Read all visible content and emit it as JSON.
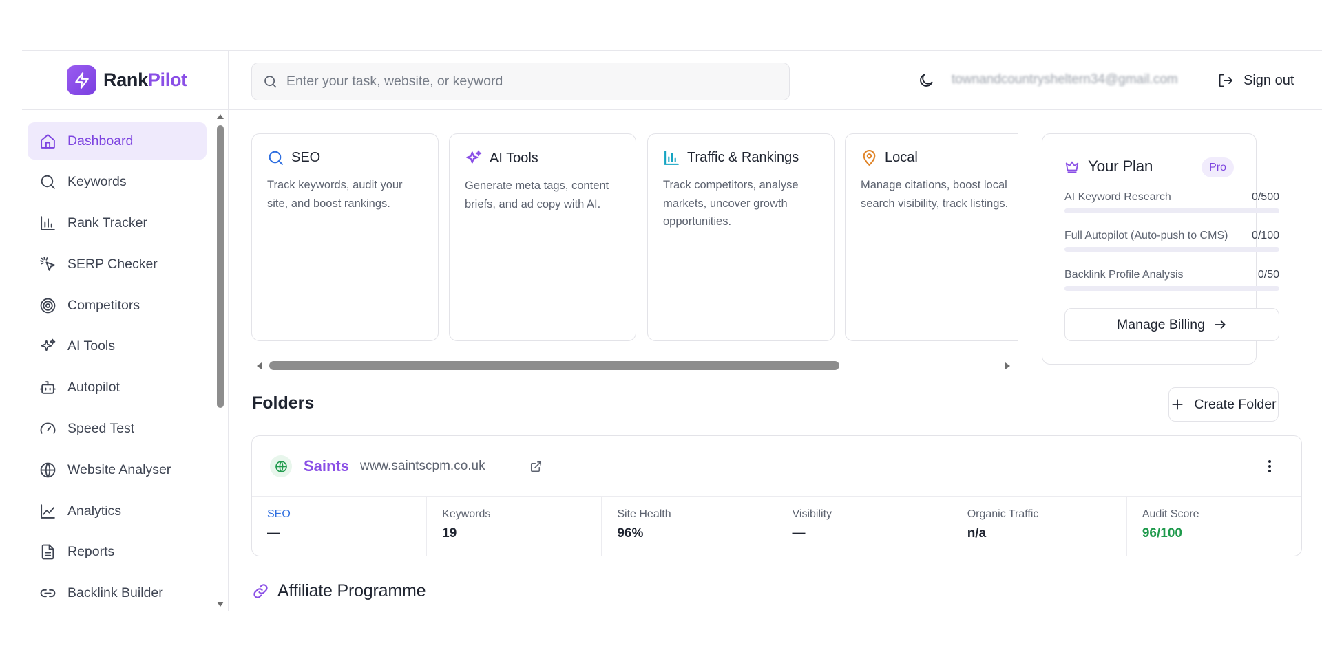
{
  "brand": {
    "name_part1": "Rank",
    "name_part2": "Pilot"
  },
  "sidebar": {
    "items": [
      {
        "label": "Dashboard",
        "icon": "home-icon",
        "active": true
      },
      {
        "label": "Keywords",
        "icon": "search-icon"
      },
      {
        "label": "Rank Tracker",
        "icon": "bar-chart-icon"
      },
      {
        "label": "SERP Checker",
        "icon": "pointer-click-icon"
      },
      {
        "label": "Competitors",
        "icon": "target-icon"
      },
      {
        "label": "AI Tools",
        "icon": "sparkles-icon"
      },
      {
        "label": "Autopilot",
        "icon": "bot-icon"
      },
      {
        "label": "Speed Test",
        "icon": "gauge-icon"
      },
      {
        "label": "Website Analyser",
        "icon": "globe-icon"
      },
      {
        "label": "Analytics",
        "icon": "line-chart-icon"
      },
      {
        "label": "Reports",
        "icon": "file-text-icon"
      },
      {
        "label": "Backlink Builder",
        "icon": "link-icon"
      }
    ]
  },
  "topbar": {
    "search_placeholder": "Enter your task, website, or keyword",
    "user_email": "townandcountrysheltern34@gmail.com",
    "signout_label": "Sign out"
  },
  "cards": [
    {
      "title": "SEO",
      "desc": "Track keywords, audit your site, and boost rankings.",
      "icon": "search-icon",
      "color": "#2f6fe0"
    },
    {
      "title": "AI Tools",
      "desc": "Generate meta tags, content briefs, and ad copy with AI.",
      "icon": "sparkles-icon",
      "color": "#8a4fe6"
    },
    {
      "title": "Traffic & Rankings",
      "desc": "Track competitors, analyse markets, uncover growth opportunities.",
      "icon": "bar-chart-icon",
      "color": "#14a4c2"
    },
    {
      "title": "Local",
      "desc": "Manage citations, boost local search visibility, track listings.",
      "icon": "map-pin-icon",
      "color": "#e0852a"
    }
  ],
  "plan": {
    "title": "Your Plan",
    "badge": "Pro",
    "usage": [
      {
        "label": "AI Keyword Research",
        "value": "0/500",
        "fraction": 0
      },
      {
        "label": "Full Autopilot (Auto-push to CMS)",
        "value": "0/100",
        "fraction": 0
      },
      {
        "label": "Backlink Profile Analysis",
        "value": "0/50",
        "fraction": 0
      }
    ],
    "billing_label": "Manage Billing"
  },
  "folders": {
    "title": "Folders",
    "create_label": "Create Folder",
    "items": [
      {
        "name": "Saints",
        "url": "www.saintscpm.co.uk",
        "metrics": [
          {
            "label": "SEO",
            "value": "—"
          },
          {
            "label": "Keywords",
            "value": "19"
          },
          {
            "label": "Site Health",
            "value": "96%"
          },
          {
            "label": "Visibility",
            "value": "—"
          },
          {
            "label": "Organic Traffic",
            "value": "n/a"
          },
          {
            "label": "Audit Score",
            "value": "96/100"
          }
        ]
      }
    ]
  },
  "affiliate": {
    "title": "Affiliate Programme"
  },
  "colors": {
    "accent": "#8a4fe6",
    "success": "#1f9a4c",
    "link_blue": "#2f6fe0"
  }
}
